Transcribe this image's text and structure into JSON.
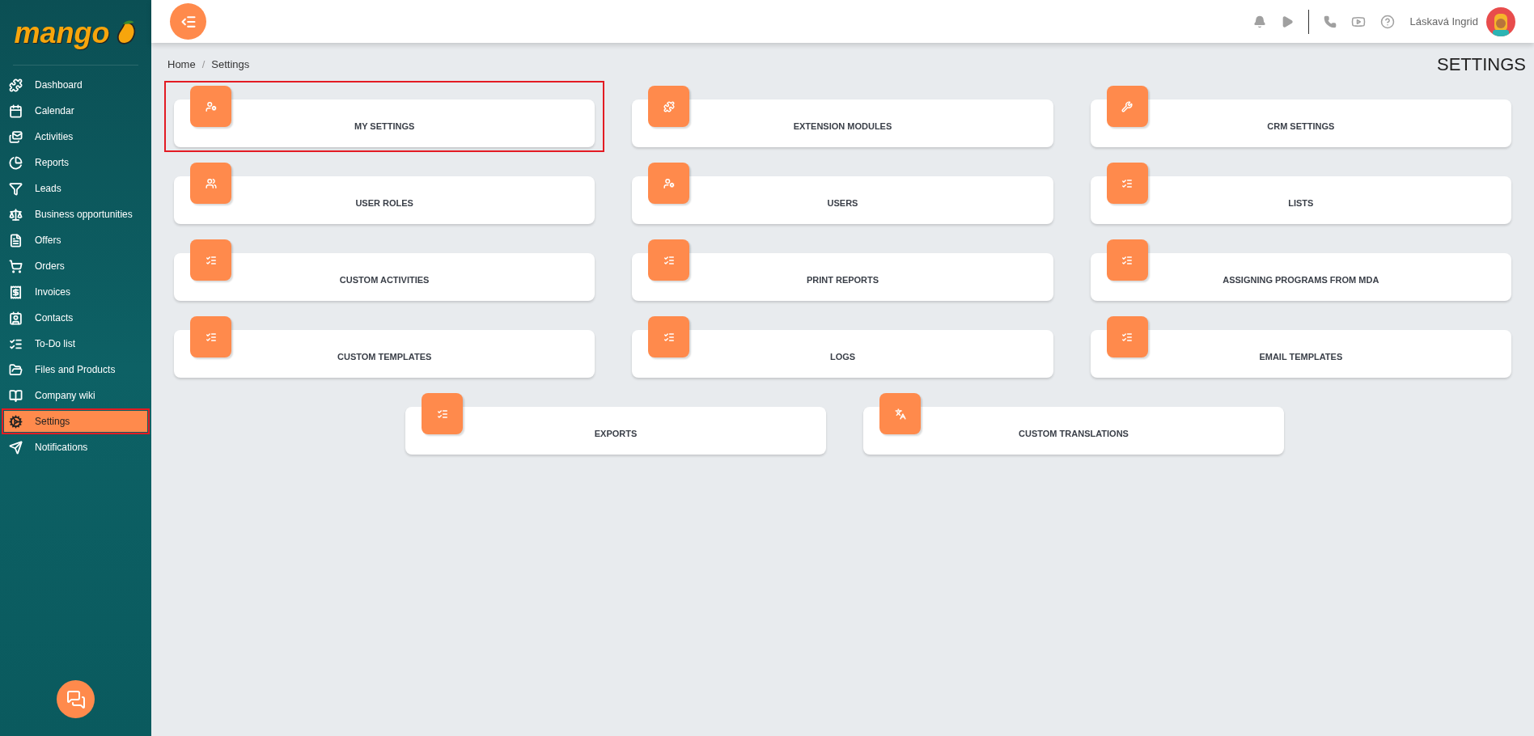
{
  "logo": {
    "text": "mango"
  },
  "sidebar": {
    "items": [
      {
        "label": "Dashboard",
        "selected": false
      },
      {
        "label": "Calendar",
        "selected": false
      },
      {
        "label": "Activities",
        "selected": false
      },
      {
        "label": "Reports",
        "selected": false
      },
      {
        "label": "Leads",
        "selected": false
      },
      {
        "label": "Business opportunities",
        "selected": false
      },
      {
        "label": "Offers",
        "selected": false
      },
      {
        "label": "Orders",
        "selected": false
      },
      {
        "label": "Invoices",
        "selected": false
      },
      {
        "label": "Contacts",
        "selected": false
      },
      {
        "label": "To-Do list",
        "selected": false
      },
      {
        "label": "Files and Products",
        "selected": false
      },
      {
        "label": "Company wiki",
        "selected": false
      },
      {
        "label": "Settings",
        "selected": true
      },
      {
        "label": "Notifications",
        "selected": false
      }
    ]
  },
  "topbar": {
    "user_name": "Láskavá Ingrid"
  },
  "breadcrumb": {
    "items": [
      "Home",
      "Settings"
    ],
    "separator": "/"
  },
  "page_title": "SETTINGS",
  "cards": [
    {
      "label": "MY SETTINGS",
      "highlighted": true
    },
    {
      "label": "EXTENSION MODULES",
      "highlighted": false
    },
    {
      "label": "CRM SETTINGS",
      "highlighted": false
    },
    {
      "label": "USER ROLES",
      "highlighted": false
    },
    {
      "label": "USERS",
      "highlighted": false
    },
    {
      "label": "LISTS",
      "highlighted": false
    },
    {
      "label": "CUSTOM ACTIVITIES",
      "highlighted": false
    },
    {
      "label": "PRINT REPORTS",
      "highlighted": false
    },
    {
      "label": "ASSIGNING PROGRAMS FROM MDA",
      "highlighted": false
    },
    {
      "label": "CUSTOM TEMPLATES",
      "highlighted": false
    },
    {
      "label": "LOGS",
      "highlighted": false
    },
    {
      "label": "EMAIL TEMPLATES",
      "highlighted": false
    },
    {
      "label": "EXPORTS",
      "highlighted": false
    },
    {
      "label": "CUSTOM TRANSLATIONS",
      "highlighted": false
    }
  ]
}
